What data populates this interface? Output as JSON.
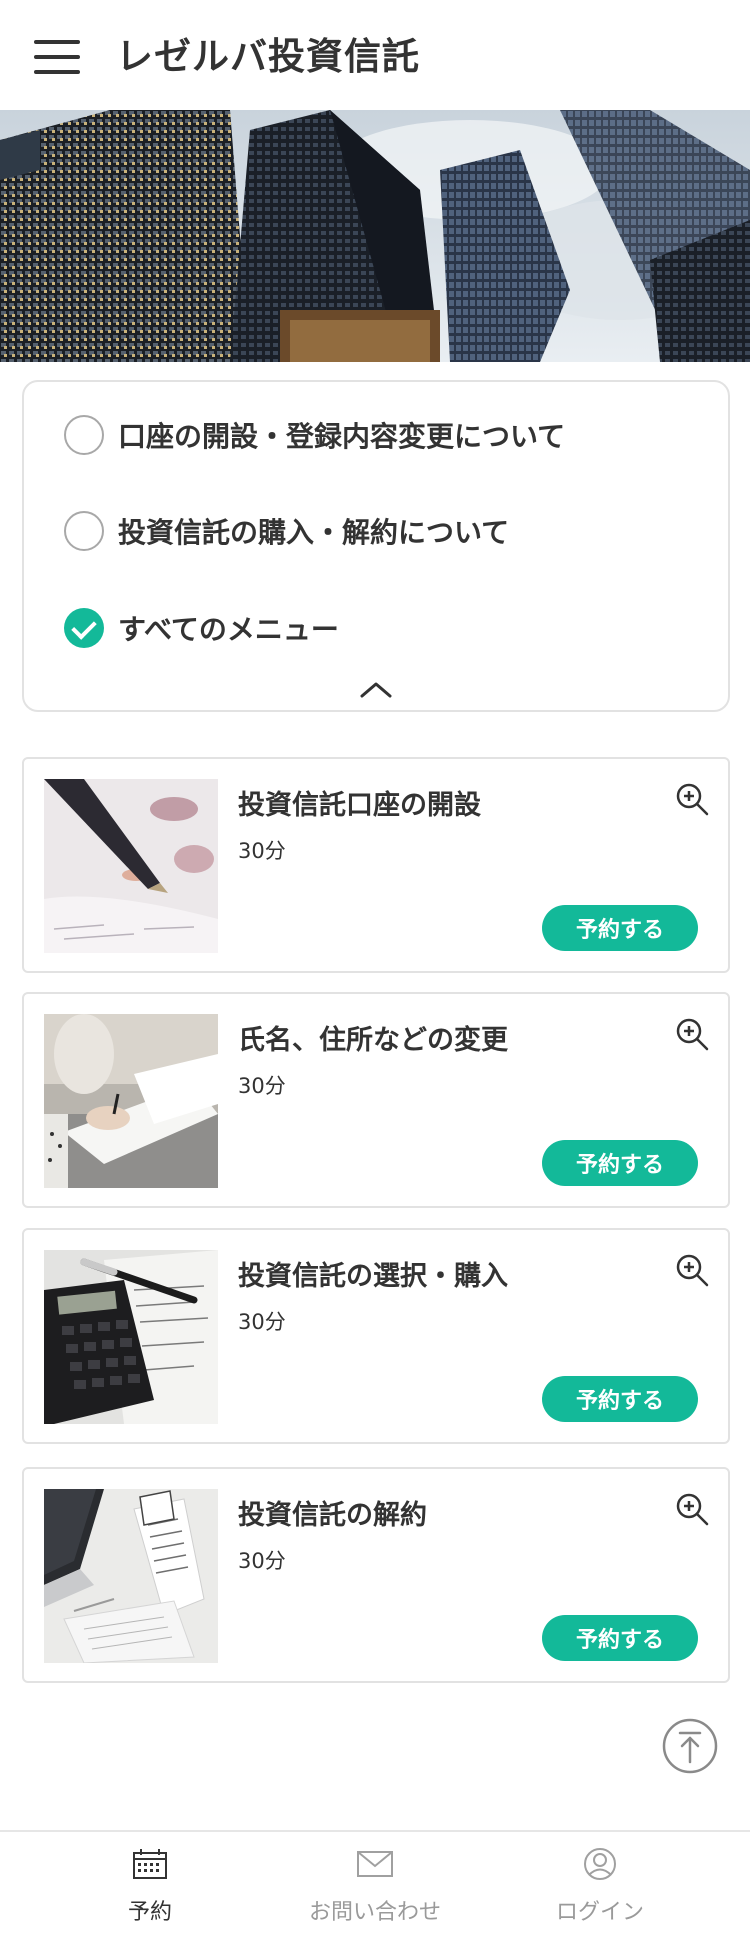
{
  "header": {
    "title": "レゼルバ投資信託"
  },
  "categories": [
    {
      "label": "口座の開設・登録内容変更について",
      "checked": false
    },
    {
      "label": "投資信託の購入・解約について",
      "checked": false
    },
    {
      "label": "すべてのメニュー",
      "checked": true
    }
  ],
  "menu_items": [
    {
      "title": "投資信託口座の開設",
      "duration": "30分",
      "button": "予約する"
    },
    {
      "title": "氏名、住所などの変更",
      "duration": "30分",
      "button": "予約する"
    },
    {
      "title": "投資信託の選択・購入",
      "duration": "30分",
      "button": "予約する"
    },
    {
      "title": "投資信託の解約",
      "duration": "30分",
      "button": "予約する"
    }
  ],
  "bottom_nav": [
    {
      "label": "予約",
      "icon": "calendar-icon",
      "active": true
    },
    {
      "label": "お問い合わせ",
      "icon": "mail-icon",
      "active": false
    },
    {
      "label": "ログイン",
      "icon": "user-icon",
      "active": false
    }
  ],
  "colors": {
    "accent": "#13b999",
    "text": "#333333",
    "muted": "#9a9a9a",
    "border": "#e2e2e2"
  }
}
